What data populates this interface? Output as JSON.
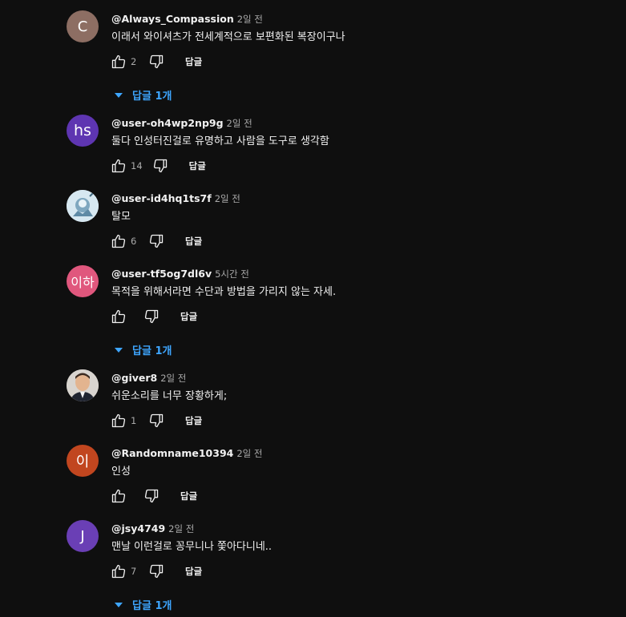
{
  "comments": [
    {
      "author": "@Always_Compassion",
      "time": "2일 전",
      "text": "이래서 와이셔츠가 전세계적으로 보편화된 복장이구나",
      "likes": "2",
      "reply_label": "답글",
      "replies": "답글 1개",
      "avatar": {
        "type": "letter",
        "letter": "C",
        "color": "#8d6e63"
      }
    },
    {
      "author": "@user-oh4wp2np9g",
      "time": "2일 전",
      "text": "둘다 인성터진걸로 유명하고 사람을 도구로 생각함",
      "likes": "14",
      "reply_label": "답글",
      "avatar": {
        "type": "letter",
        "letter": "hs",
        "color": "#5e35b1"
      }
    },
    {
      "author": "@user-id4hq1ts7f",
      "time": "2일 전",
      "text": "탈모",
      "likes": "6",
      "reply_label": "답글",
      "avatar": {
        "type": "image",
        "color": "#9fc3d6"
      }
    },
    {
      "author": "@user-tf5og7dl6v",
      "time": "5시간 전",
      "text": "목적을 위해서라면 수단과 방법을 가리지 않는 자세.",
      "likes": "",
      "reply_label": "답글",
      "replies": "답글 1개",
      "avatar": {
        "type": "letter",
        "letter": "이하",
        "color": "#e0577d"
      }
    },
    {
      "author": "@giver8",
      "time": "2일 전",
      "text": "쉬운소리를 너무 장황하게;",
      "likes": "1",
      "reply_label": "답글",
      "avatar": {
        "type": "image",
        "color": "#c9c4bd"
      }
    },
    {
      "author": "@Randomname10394",
      "time": "2일 전",
      "text": "인성",
      "likes": "",
      "reply_label": "답글",
      "avatar": {
        "type": "letter",
        "letter": "이",
        "color": "#c1461f"
      }
    },
    {
      "author": "@jsy4749",
      "time": "2일 전",
      "text": "맨날 이런걸로 꽁무니나 쫓아다니네..",
      "likes": "7",
      "reply_label": "답글",
      "replies": "답글 1개",
      "avatar": {
        "type": "letter",
        "letter": "J",
        "color": "#6a3fb5"
      }
    }
  ],
  "colors": {
    "background": "#0f0f0f",
    "text_primary": "#f1f1f1",
    "text_secondary": "#aaaaaa",
    "link_blue": "#3ea6ff"
  }
}
